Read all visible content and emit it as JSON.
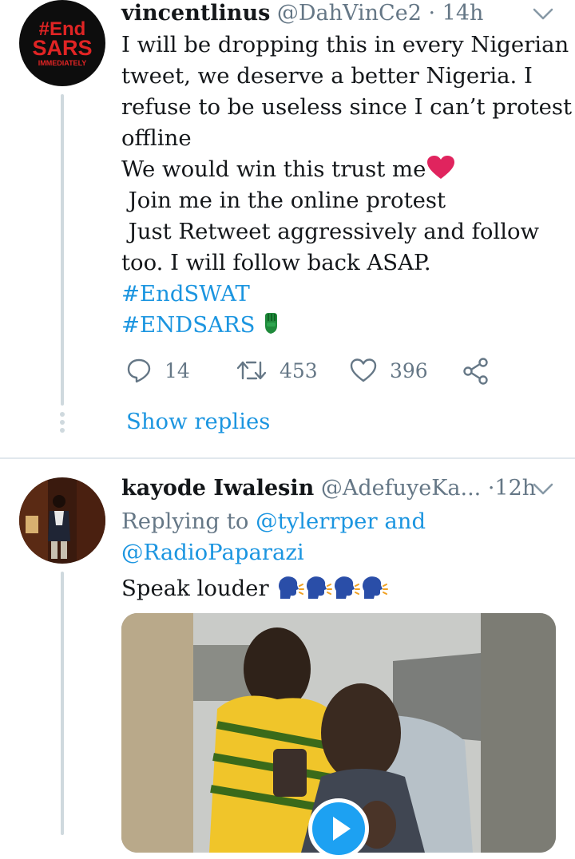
{
  "tweet1": {
    "avatar_lines": [
      "#End",
      "SARS",
      "IMMEDIATELY"
    ],
    "display_name": "vincentlinus",
    "handle": "@DahVinCe2",
    "sep": "·",
    "time": "14h",
    "lines": [
      "I will be dropping this in every Nigerian",
      "tweet, we deserve a better Nigeria. I",
      "refuse to be useless since I can’t protest",
      "offline",
      "We would win this trust me",
      " Join me in the online protest",
      " Just Retweet aggressively and follow",
      "too. I will follow back ASAP."
    ],
    "hashtags": [
      "#EndSWAT",
      "#ENDSARS"
    ],
    "counts": {
      "replies": "14",
      "retweets": "453",
      "likes": "396"
    },
    "show_replies": "Show replies"
  },
  "tweet2": {
    "display_name": "kayode Iwalesin",
    "handle": "@AdefuyeKa...",
    "sep": "·",
    "time": "12h",
    "replying_prefix": "Replying to",
    "replying_user1": "@tylerrper",
    "replying_and": "and",
    "replying_user2": "@RadioPaparazi",
    "text": "Speak louder"
  },
  "colors": {
    "link": "#1b95e0",
    "muted": "#657786",
    "heart": "#e0245e",
    "avatar_red": "#e02424"
  },
  "icons": [
    "chevron-down-icon",
    "reply-icon",
    "retweet-icon",
    "like-icon",
    "share-icon",
    "heart-emoji-icon",
    "fist-emoji-icon",
    "speaking-head-emoji-icon",
    "play-icon"
  ]
}
